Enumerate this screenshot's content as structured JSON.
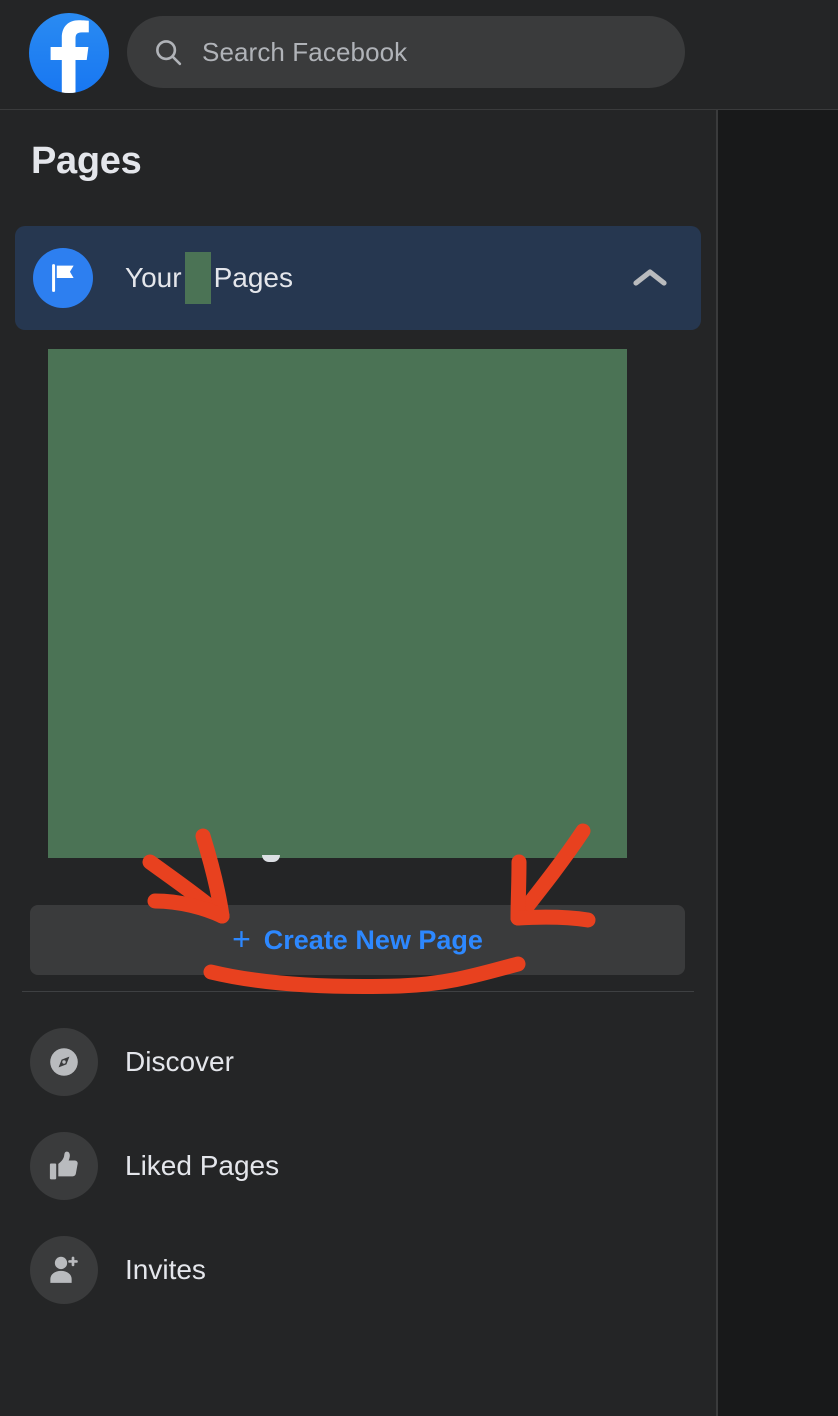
{
  "header": {
    "logo_icon": "facebook-logo-icon",
    "search": {
      "icon": "search-icon",
      "placeholder": "Search Facebook",
      "value": ""
    }
  },
  "sidebar": {
    "title": "Pages",
    "your_pages": {
      "icon": "flag-icon",
      "label_before": "Your",
      "label_after": "Pages",
      "redacted": true,
      "expanded": true,
      "chevron_icon": "chevron-up-icon"
    },
    "redaction": {
      "color": "#4b7355",
      "note": "page list content hidden"
    },
    "create_new_page": {
      "plus": "+",
      "label": "Create New Page"
    },
    "items": [
      {
        "label": "Discover",
        "icon": "discover-icon"
      },
      {
        "label": "Liked Pages",
        "icon": "thumbs-up-icon"
      },
      {
        "label": "Invites",
        "icon": "person-add-icon"
      }
    ]
  },
  "annotations": {
    "color": "#e8411f",
    "marks": [
      {
        "name": "arrow-left-down",
        "shape": "arrow"
      },
      {
        "name": "arrow-right-down",
        "shape": "arrow"
      },
      {
        "name": "underline-squiggle",
        "shape": "underline"
      }
    ]
  },
  "colors": {
    "background": "#18191a",
    "surface": "#242526",
    "surface_raised": "#3a3b3c",
    "accent_blue": "#2d88ff",
    "highlight_row": "#263750",
    "text_primary": "#e4e6eb",
    "text_secondary": "#b0b3b8",
    "annotation_red": "#e8411f",
    "redaction_green": "#4b7355"
  }
}
